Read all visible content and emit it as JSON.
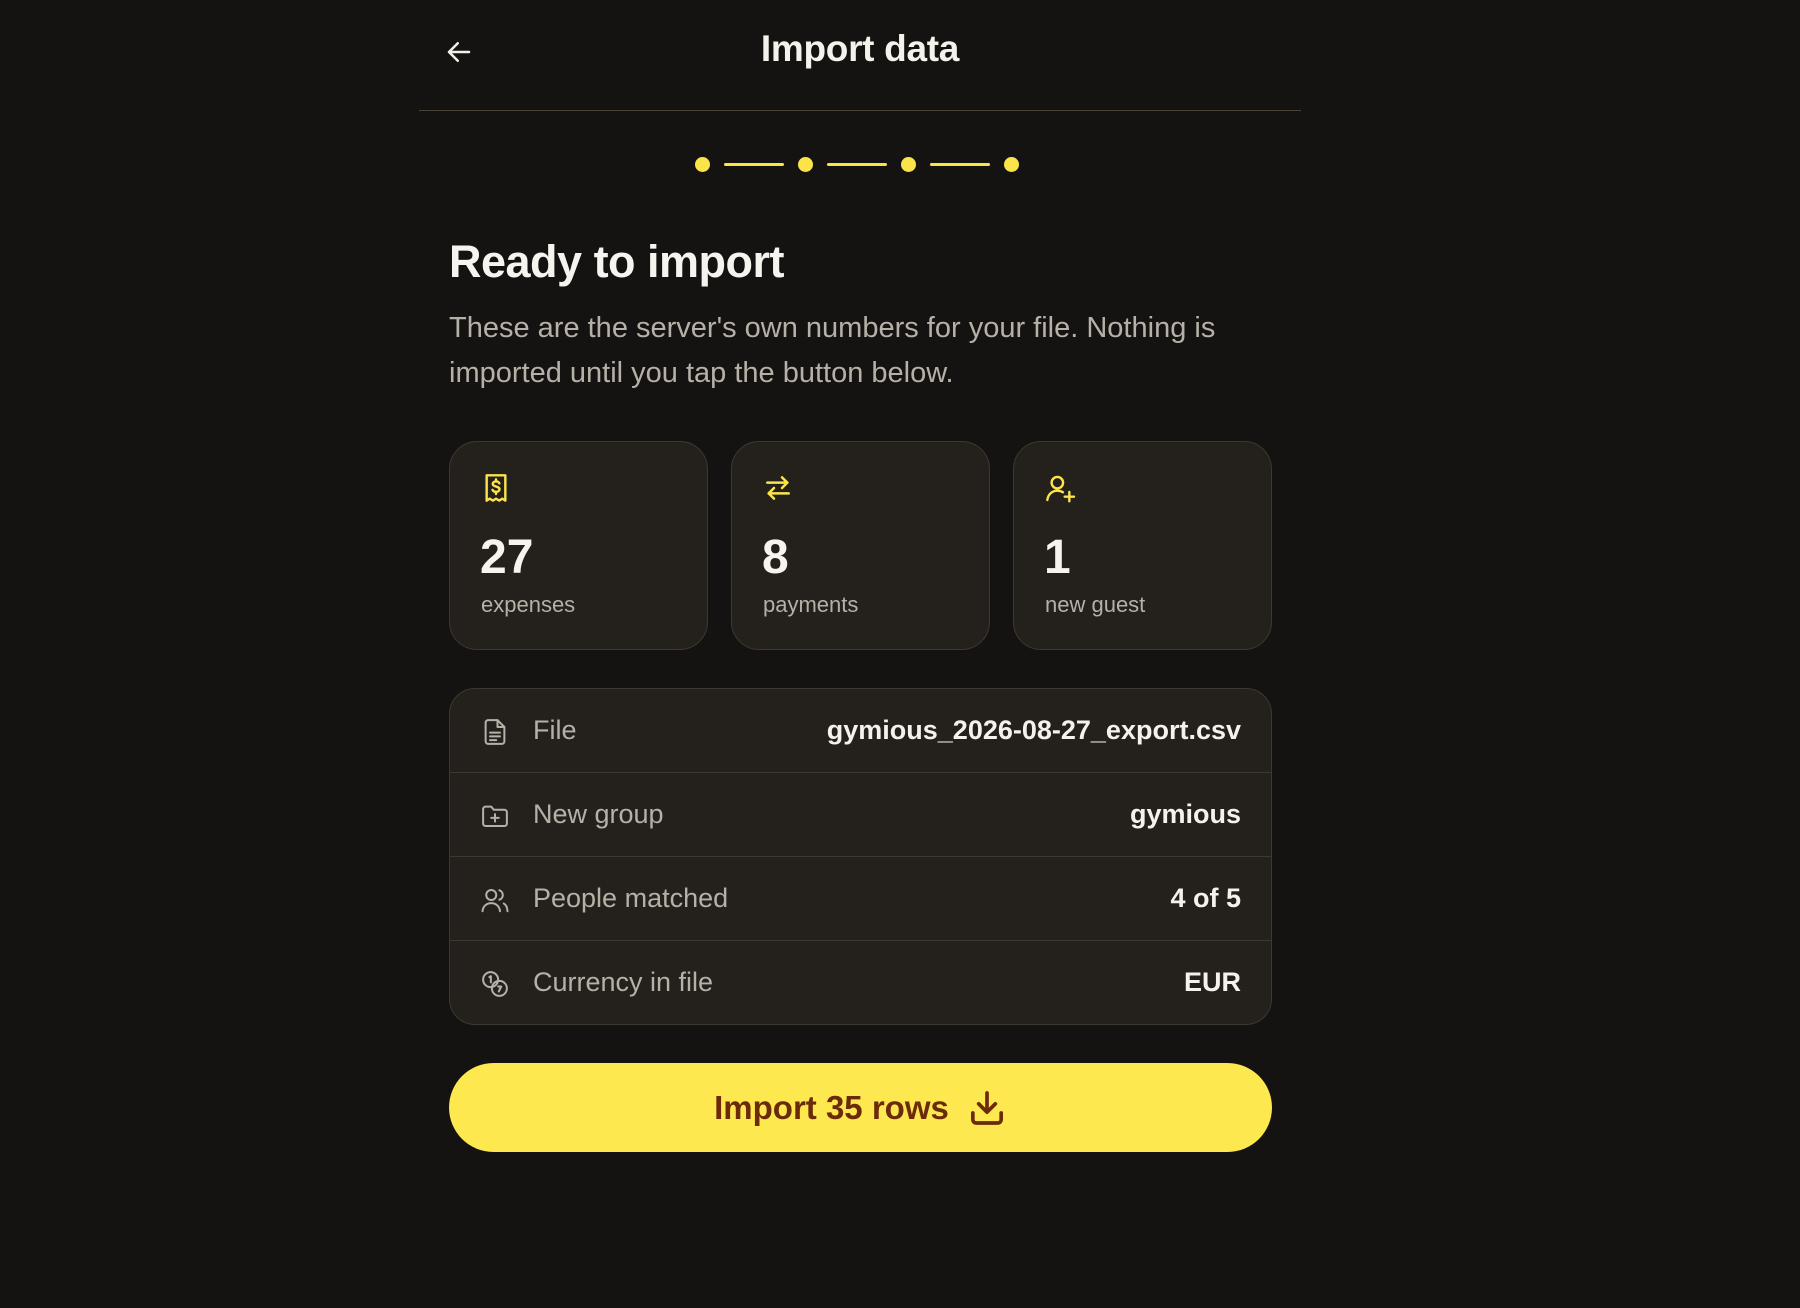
{
  "header": {
    "title": "Import data",
    "back_icon": "arrow-left-icon"
  },
  "stepper": {
    "total_steps": 4,
    "current_step": 4
  },
  "main": {
    "heading": "Ready to import",
    "description": "These are the server's own numbers for your file. Nothing is imported until you tap the button below."
  },
  "summary": [
    {
      "icon": "receipt-dollar-icon",
      "count": "27",
      "label": "expenses"
    },
    {
      "icon": "arrows-swap-icon",
      "count": "8",
      "label": "payments"
    },
    {
      "icon": "user-plus-icon",
      "count": "1",
      "label": "new guest"
    }
  ],
  "details": [
    {
      "icon": "file-icon",
      "label": "File",
      "value": "gymious_2026-08-27_export.csv"
    },
    {
      "icon": "folder-plus-icon",
      "label": "New group",
      "value": "gymious"
    },
    {
      "icon": "users-icon",
      "label": "People matched",
      "value": "4 of 5"
    },
    {
      "icon": "coins-icon",
      "label": "Currency in file",
      "value": "EUR"
    }
  ],
  "action": {
    "label": "Import 35 rows",
    "icon": "download-icon"
  },
  "colors": {
    "background": "#141312",
    "accent": "#fde84f",
    "card": "#24201b",
    "button_text": "#6b2a0a"
  }
}
